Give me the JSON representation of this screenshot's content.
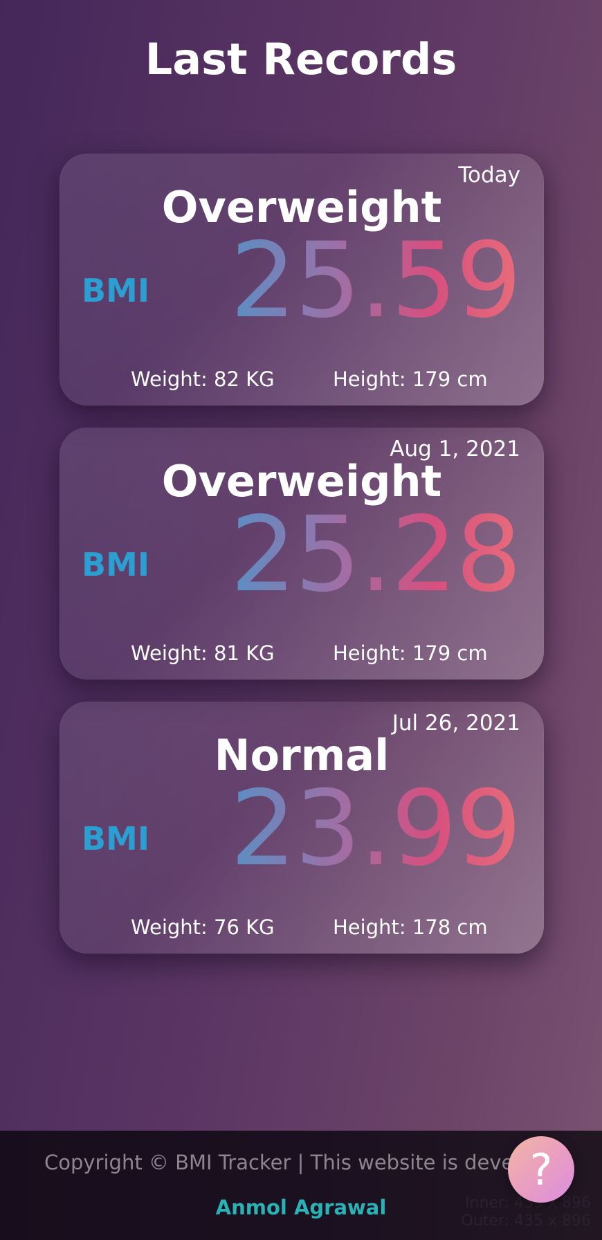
{
  "header": {
    "title": "Last Records"
  },
  "records": [
    {
      "date": "Today",
      "category": "Overweight",
      "bmi_label": "BMI",
      "bmi_value": "25.59",
      "weight": "Weight: 82 KG",
      "height": "Height: 179 cm"
    },
    {
      "date": "Aug 1, 2021",
      "category": "Overweight",
      "bmi_label": "BMI",
      "bmi_value": "25.28",
      "weight": "Weight: 81 KG",
      "height": "Height: 179 cm"
    },
    {
      "date": "Jul 26, 2021",
      "category": "Normal",
      "bmi_label": "BMI",
      "bmi_value": "23.99",
      "weight": "Weight: 76 KG",
      "height": "Height: 178 cm"
    }
  ],
  "footer": {
    "copyright": "Copyright © BMI Tracker | This website is develop",
    "author": "Anmol Agrawal",
    "debug_inner": "Inner: 435 x 896",
    "debug_outer": "Outer: 435 x 896"
  },
  "help_button": {
    "label": "?"
  },
  "colors": {
    "bmi_label": "#2b9fd1",
    "author": "#2ab3b5",
    "value_gradient_start": "#5a8fc4",
    "value_gradient_end": "#e86c7a"
  }
}
